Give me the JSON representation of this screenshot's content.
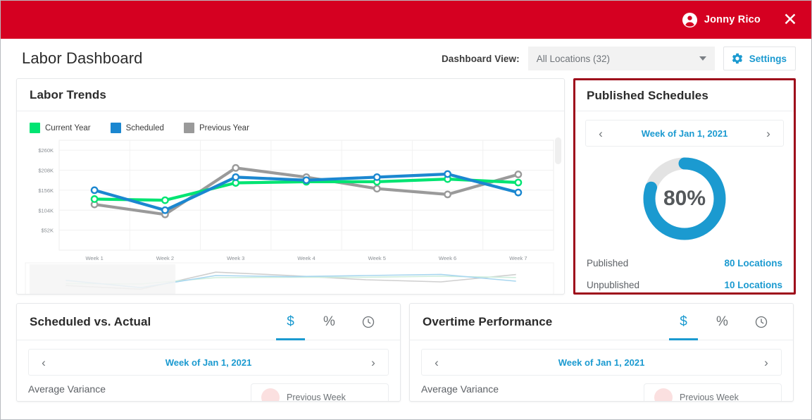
{
  "topbar": {
    "user_name": "Jonny Rico",
    "avatar_icon": "account-circle-icon",
    "close_icon": "close-icon",
    "bar_color": "#d50021"
  },
  "header": {
    "title": "Labor Dashboard",
    "dashboard_view_label": "Dashboard View:",
    "dashboard_view_value": "All Locations (32)",
    "dashboard_view_caret": "chevron-down-icon",
    "settings_label": "Settings",
    "settings_icon": "gear-icon",
    "accent_color": "#1b9ad0"
  },
  "labor_trends": {
    "title": "Labor Trends"
  },
  "published": {
    "title": "Published Schedules",
    "week_label": "Week of Jan 1, 2021",
    "prev_arrow": "‹",
    "next_arrow": "›",
    "percent": "80%",
    "percent_value": 80,
    "rows": [
      {
        "label": "Published",
        "value": "80 Locations"
      },
      {
        "label": "Unpublished",
        "value": "10 Locations"
      }
    ],
    "donut_color": "#1b9ad0",
    "donut_track_color": "#e3e3e3",
    "highlight_border_color": "#9e0b1b"
  },
  "bottom_cards": [
    {
      "title": "Scheduled vs. Actual",
      "tabs": [
        {
          "label": "$",
          "icon": "dollar-icon",
          "active": true
        },
        {
          "label": "%",
          "icon": "percent-icon",
          "active": false
        },
        {
          "label": "○",
          "icon": "clock-icon",
          "active": false
        }
      ],
      "week_label": "Week of Jan 1, 2021",
      "prev_arrow": "‹",
      "next_arrow": "›",
      "metric_label": "Average Variance",
      "compare_label": "Previous Week"
    },
    {
      "title": "Overtime Performance",
      "tabs": [
        {
          "label": "$",
          "icon": "dollar-icon",
          "active": true
        },
        {
          "label": "%",
          "icon": "percent-icon",
          "active": false
        },
        {
          "label": "○",
          "icon": "clock-icon",
          "active": false
        }
      ],
      "week_label": "Week of Jan 1, 2021",
      "prev_arrow": "‹",
      "next_arrow": "›",
      "metric_label": "Average Variance",
      "compare_label": "Previous Week"
    }
  ],
  "chart_data": {
    "type": "line",
    "title": "Labor Trends",
    "xlabel": "",
    "ylabel": "",
    "grid": true,
    "legend_position": "top-left",
    "categories": [
      "Week 1",
      "Week 2",
      "Week 3",
      "Week 4",
      "Week 5",
      "Week 6",
      "Week 7"
    ],
    "ytick_labels": [
      "$260K",
      "$208K",
      "$156K",
      "$104K",
      "$52K"
    ],
    "ytick_values": [
      260000,
      208000,
      156000,
      104000,
      52000
    ],
    "ylim": [
      0,
      286000
    ],
    "series": [
      {
        "name": "Current Year",
        "color": "#00e472",
        "values": [
          133000,
          130000,
          175000,
          178000,
          178000,
          185000,
          176000
        ]
      },
      {
        "name": "Scheduled",
        "color": "#1b87d0",
        "values": [
          156000,
          104000,
          190000,
          182000,
          190000,
          198000,
          150000
        ]
      },
      {
        "name": "Previous Year",
        "color": "#9a9a9a",
        "values": [
          119000,
          93000,
          214000,
          190000,
          160000,
          145000,
          197000
        ]
      }
    ],
    "navigator": {
      "visible": true,
      "selection_start_category": "Week 1",
      "selection_end_category": "Week 2"
    }
  }
}
